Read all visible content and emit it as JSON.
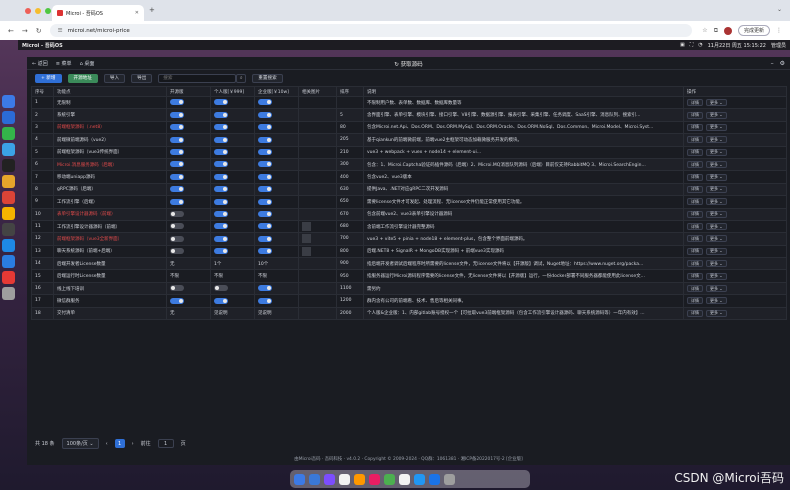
{
  "browser": {
    "tab_title": "Microi - 吾码OS",
    "url": "microi.net/microi-price",
    "update_label": "完成更新"
  },
  "menubar": {
    "app_name": "Microi - 吾码OS",
    "datetime": "11月22日 周五 15:15:22",
    "user": "管理员"
  },
  "app_header": {
    "back_label": "← 返回",
    "menu_label": "≡ 菜单",
    "home_label": "⌂ 桌面",
    "title": "获取源码"
  },
  "toolbar": {
    "add_label": "+ 新增",
    "open_label": "开源地址",
    "import_label": "导入",
    "export_label": "导出",
    "search_placeholder": "搜索",
    "reset_label": "重置搜索"
  },
  "table": {
    "columns": [
      "序号",
      "功能点",
      "开源版",
      "个人版[￥999]",
      "企业版[￥10w]",
      "相关图片",
      "排序",
      "说明",
      "操作"
    ],
    "rows": [
      {
        "no": "1",
        "name": "无限制",
        "red": false,
        "open": "on",
        "personal": "on",
        "enterprise": "on",
        "img": false,
        "sort": "",
        "desc": "不限制用户数、表单数、数据库、数据库数量等"
      },
      {
        "no": "2",
        "name": "系统引擎",
        "red": false,
        "open": "on",
        "personal": "on",
        "enterprise": "on",
        "img": false,
        "sort": "5",
        "desc": "含界面引擎、表单引擎、模块引擎、接口引擎、V8引擎、数据源引擎、报表引擎、采集引擎、任务调度、SaaS引擎、消息队列、搜索引..."
      },
      {
        "no": "3",
        "name": "前端框架源码（.net8）",
        "red": true,
        "open": "on",
        "personal": "on",
        "enterprise": "on",
        "img": false,
        "sort": "80",
        "desc": "包含Microi.net.Api、Dos.ORM、Dos.ORM.MySql、Dos.ORM.Oracle、Dos.ORM.NoSql、Dos.Common、Microi.Model、Microi.Syst..."
      },
      {
        "no": "4",
        "name": "前端微前端源码（vue2）",
        "red": false,
        "open": "on",
        "personal": "on",
        "enterprise": "on",
        "img": false,
        "sort": "205",
        "desc": "基于qiankun的前端微前端，前端vue2主框架可动态加载微服务开发的模块。"
      },
      {
        "no": "5",
        "name": "前端框架源码（vue3传统界面）",
        "red": false,
        "open": "on",
        "personal": "on",
        "enterprise": "on",
        "img": false,
        "sort": "210",
        "desc": "vue3 + webpack + vuex + node14 + element-ui..."
      },
      {
        "no": "6",
        "name": "Microi.消息服务源码（后端）",
        "red": true,
        "open": "on",
        "personal": "on",
        "enterprise": "on",
        "img": false,
        "sort": "300",
        "desc": "包含：1、Microi.Captcha验证码插件源码（后端）2、Microi.MQ消息队列源码（后端）目前仅支持RabbitMQ 3、Microi.SearchEngin..."
      },
      {
        "no": "7",
        "name": "移动端uniapp源码",
        "red": false,
        "open": "on",
        "personal": "on",
        "enterprise": "on",
        "img": false,
        "sort": "400",
        "desc": "包含vue2、vue3版本"
      },
      {
        "no": "8",
        "name": "gRPC源码（后端）",
        "red": false,
        "open": "on",
        "personal": "on",
        "enterprise": "on",
        "img": false,
        "sort": "630",
        "desc": "提供Java、.NET对应gRPC二次开发源码"
      },
      {
        "no": "9",
        "name": "工作流引擎（后端）",
        "red": false,
        "open": "on",
        "personal": "on",
        "enterprise": "on",
        "img": false,
        "sort": "650",
        "desc": "需要license文件才可发起、处理流程、无license文件仍能正常使用其它功能。"
      },
      {
        "no": "10",
        "name": "表单引擎设计器源码（前端）",
        "red": true,
        "open": "off",
        "personal": "on",
        "enterprise": "on",
        "img": false,
        "sort": "670",
        "desc": "包含前端vue2、vue3表单引擎设计器源码"
      },
      {
        "no": "11",
        "name": "工作流引擎设计器源码（前端）",
        "red": false,
        "open": "off",
        "personal": "on",
        "enterprise": "on",
        "img": true,
        "sort": "680",
        "desc": "含前端工作流引擎设计器完整源码"
      },
      {
        "no": "12",
        "name": "前端框架源码（vue3全新界面）",
        "red": true,
        "open": "off",
        "personal": "on",
        "enterprise": "on",
        "img": true,
        "sort": "700",
        "desc": "vue3 + vite5 + pinia + node18 + element-plus，包含整个界面前端源码。"
      },
      {
        "no": "13",
        "name": "聊天系统源码（前端+后端）",
        "red": false,
        "open": "off",
        "personal": "on",
        "enterprise": "on",
        "img": true,
        "sort": "800",
        "desc": "后端.NET8 + SignalR + MongoDB实现源码 + 前端vue3实现源码"
      },
      {
        "no": "14",
        "name": "后端开发者License数量",
        "red": false,
        "open": "text",
        "open_text": "无",
        "personal": "text",
        "personal_text": "1个",
        "enterprise": "text",
        "enterprise_text": "10个",
        "img": false,
        "sort": "900",
        "desc": "指后端开发者调试后端程序时所需要的license文件，无license文件将以【开源版】调试，Nuget地址：https://www.nuget.org/packa..."
      },
      {
        "no": "15",
        "name": "后端运行时License数量",
        "red": false,
        "open": "text",
        "open_text": "不限",
        "personal": "text",
        "personal_text": "不限",
        "enterprise": "text",
        "enterprise_text": "不限",
        "img": false,
        "sort": "950",
        "desc": "指服务器运行Microi源码程序需要的license文件，无license文件将以【开源版】运行，一份docker部署不同服务器都能使用此license文..."
      },
      {
        "no": "16",
        "name": "线上线下培训",
        "red": false,
        "open": "off",
        "personal": "off",
        "enterprise": "on",
        "img": false,
        "sort": "1100",
        "desc": "需另约"
      },
      {
        "no": "17",
        "name": "微信群服务",
        "red": false,
        "open": "on",
        "personal": "on",
        "enterprise": "on",
        "img": false,
        "sort": "1200",
        "desc": "群内含有公司的前端看、技术、售后等相关同事。"
      },
      {
        "no": "18",
        "name": "交付清单",
        "red": false,
        "open": "text",
        "open_text": "无",
        "personal": "text",
        "personal_text": "见说明",
        "enterprise": "text",
        "enterprise_text": "见说明",
        "img": false,
        "sort": "2000",
        "desc": "个人版&企业版：1、内部gitlab账号授权一个【可拉取vue3前端框架源码（包含工作流引擎设计器源码、聊天系统源码等）一年内有效】..."
      }
    ],
    "detail_label": "详情",
    "more_label": "更多 ⌄"
  },
  "pager": {
    "total": "共 18 条",
    "page_size": "100条/页",
    "current": "1",
    "goto_label": "前往",
    "goto_value": "1",
    "page_suffix": "页"
  },
  "footer": {
    "text": "由Microi吾码 · 吾码科技 · v4.0.2 · Copyright © 2009-2024 · QQ群：1061381 · 湘ICP备2022017号-2 [企业版]"
  },
  "watermark": "CSDN @Microi吾码",
  "colors": {
    "accent": "#2f6fd6",
    "danger": "#e34b4b",
    "switch_off": "#4a4d57"
  }
}
